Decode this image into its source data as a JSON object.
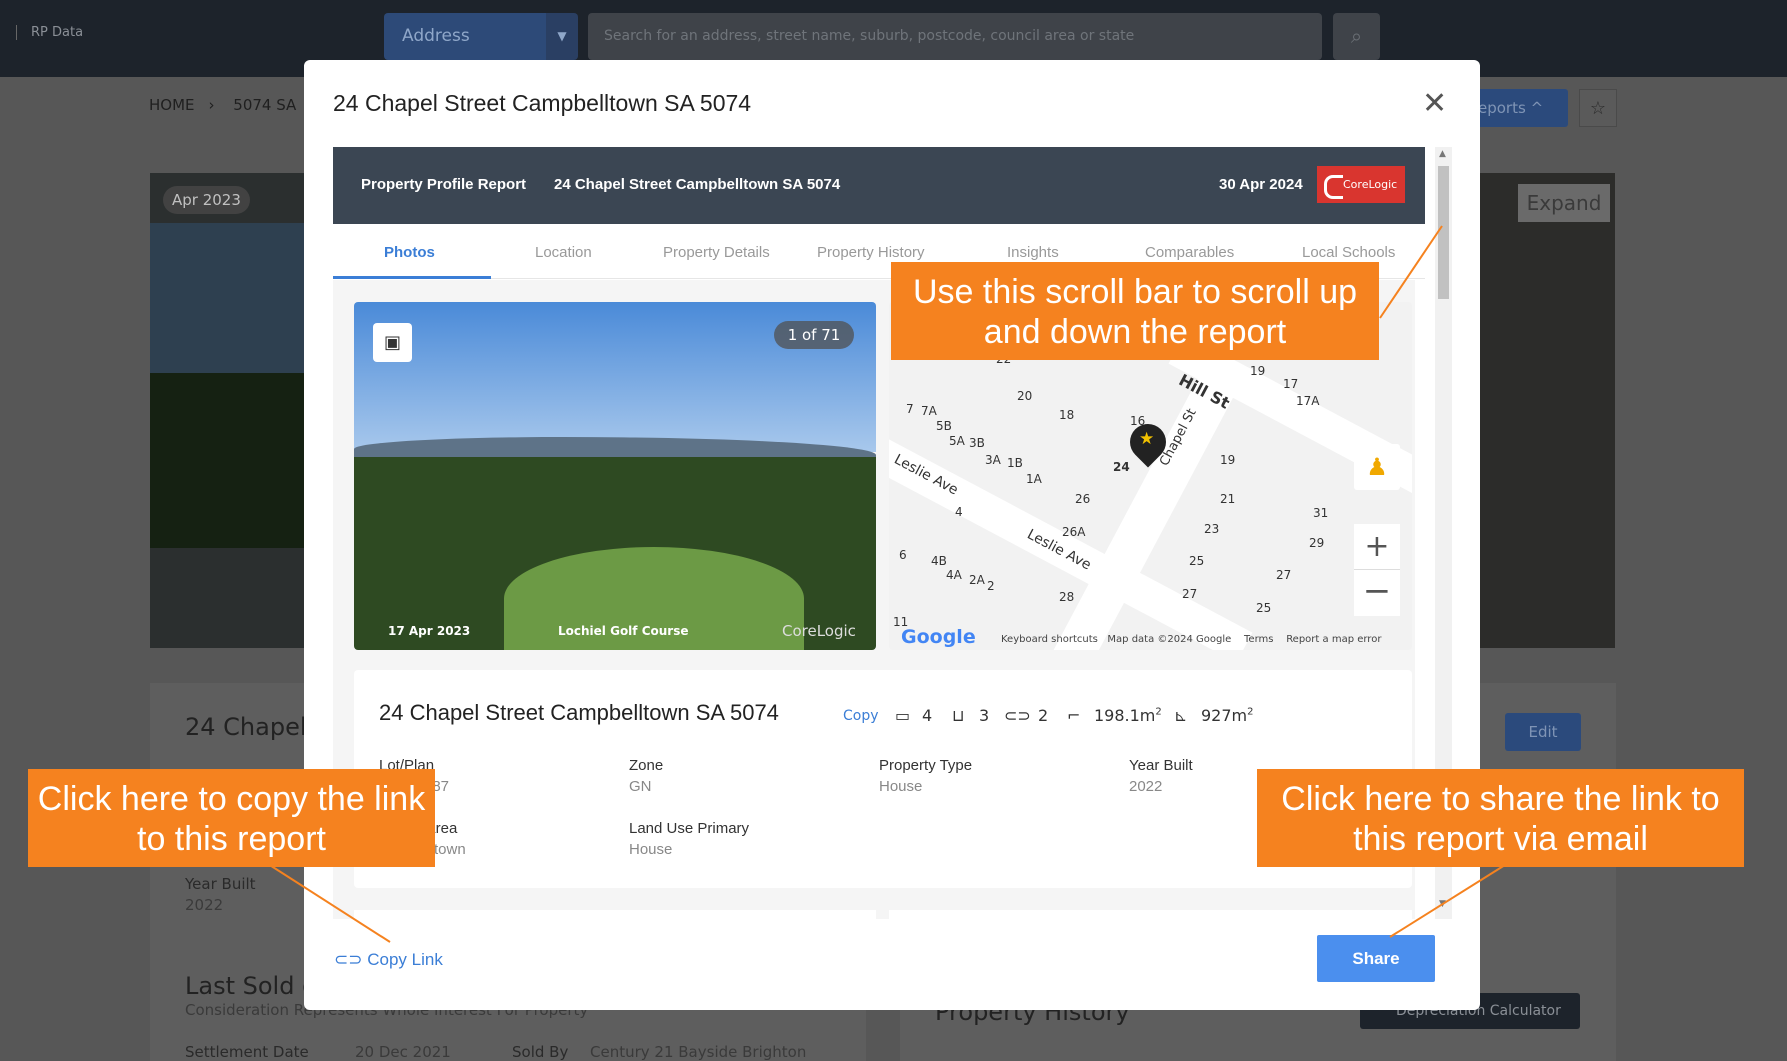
{
  "topbar": {
    "brand": "RP Data",
    "address_select": "Address",
    "search_placeholder": "Search for an address, street name, suburb, postcode, council area or state"
  },
  "breadcrumb": [
    "HOME",
    "5074 SA"
  ],
  "background": {
    "photo_tag": "Apr 2023",
    "expand": "Expand",
    "reports_btn": "eports",
    "card_title": "24 Chapel",
    "edit_btn": "Edit",
    "year_built_label": "Year Built",
    "year_built_value": "2022",
    "last_sold": "Last Sold o",
    "consideration": "Consideration Represents Whole Interest For Property",
    "settlement_label": "Settlement Date",
    "settlement_value": "20 Dec 2021",
    "sold_by_label": "Sold By",
    "sold_by_value": "Century 21 Bayside Brighton",
    "property_history": "Property History",
    "depreciation": "Depreciation Calculator"
  },
  "modal": {
    "title": "24 Chapel Street Campbelltown SA 5074",
    "report_type": "Property Profile Report",
    "report_address": "24 Chapel Street Campbelltown SA 5074",
    "report_date": "30 Apr 2024",
    "logo": "CoreLogic",
    "tabs": [
      "Photos",
      "Location",
      "Property Details",
      "Property History",
      "Insights",
      "Comparables",
      "Local Schools"
    ],
    "photo": {
      "counter": "1 of 71",
      "date": "17 Apr 2023",
      "caption": "Lochiel Golf Course",
      "watermark": "CoreLogic"
    },
    "map": {
      "streets": [
        "Hill St",
        "Chapel St",
        "Leslie Ave",
        "Leslie Ave"
      ],
      "numbers": [
        "20",
        "18",
        "16",
        "19",
        "17",
        "17A",
        "7",
        "7A",
        "5B",
        "5A",
        "3B",
        "3A",
        "1B",
        "1A",
        "24",
        "19",
        "26",
        "21",
        "4",
        "26A",
        "23",
        "29",
        "31",
        "6",
        "4B",
        "4A",
        "2A",
        "2",
        "28",
        "25",
        "27",
        "27",
        "25",
        "11",
        "22"
      ],
      "google": "Google",
      "footer": [
        "Keyboard shortcuts",
        "Map data ©2024 Google",
        "Terms",
        "Report a map error"
      ]
    },
    "info": {
      "address": "24 Chapel Street Campbelltown SA 5074",
      "copy": "Copy",
      "beds": "4",
      "baths": "3",
      "cars": "2",
      "floor_area": "198.1m",
      "land_area": "927m",
      "sq": "2",
      "fields": [
        {
          "label": "Lot/Plan",
          "value": "587"
        },
        {
          "label": "Zone",
          "value": "GN"
        },
        {
          "label": "Property Type",
          "value": "House"
        },
        {
          "label": "Year Built",
          "value": "2022"
        },
        {
          "label": "l Area",
          "value": "elltown"
        },
        {
          "label": "Land Use Primary",
          "value": "House"
        }
      ]
    },
    "copy_link": "Copy Link",
    "share": "Share"
  },
  "callouts": {
    "scroll": "Use this scroll bar to scroll up and down the report",
    "copy": "Click here to copy the link to this report",
    "share": "Click here to share the link to this report via email"
  },
  "colors": {
    "callout": "#f5821f",
    "accent": "#3b7ed6",
    "header": "#3b4653"
  }
}
